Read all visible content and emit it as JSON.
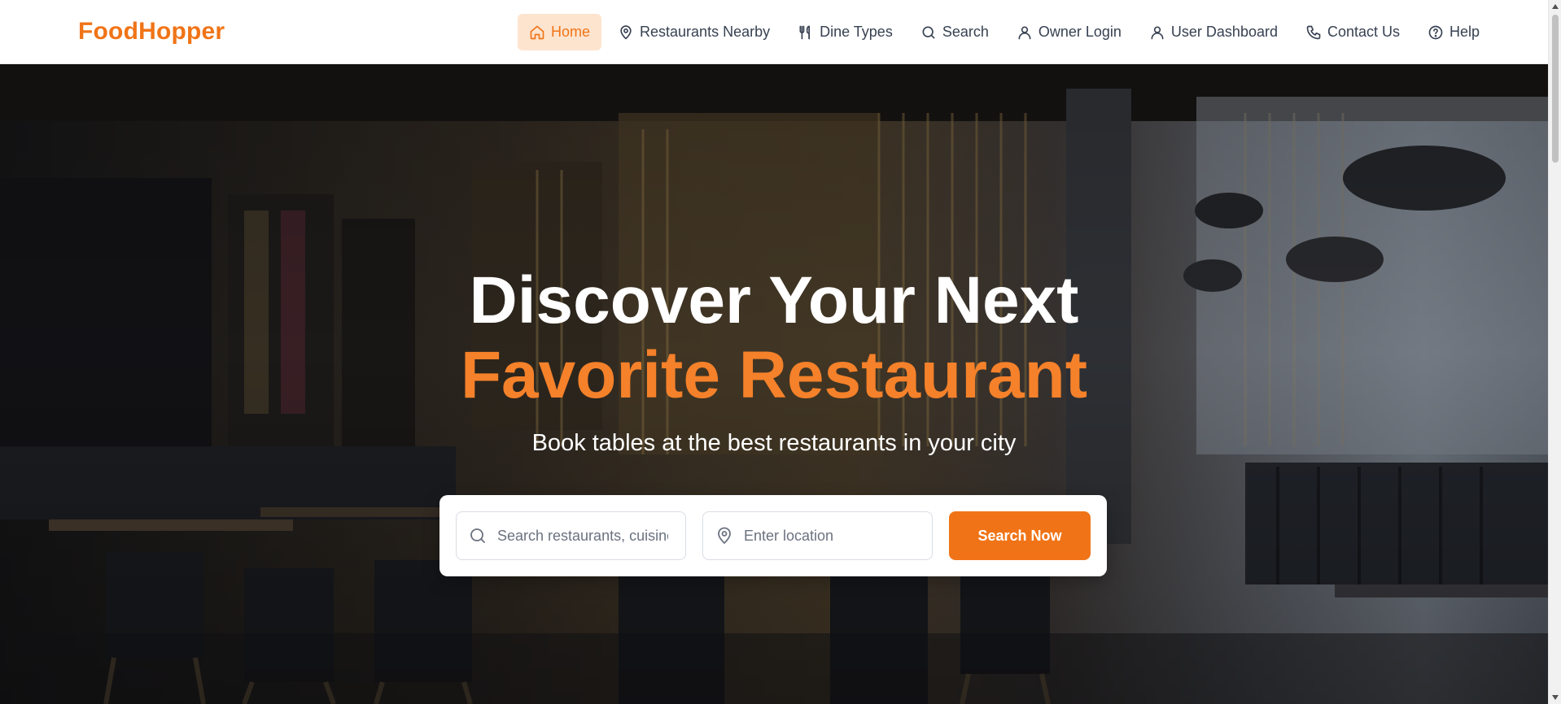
{
  "brand": {
    "name": "FoodHopper",
    "accent_color": "#f07417",
    "accent_light": "#fde4cf"
  },
  "nav": {
    "items": [
      {
        "label": "Home",
        "icon": "home-icon",
        "active": true
      },
      {
        "label": "Restaurants Nearby",
        "icon": "map-pin-icon",
        "active": false
      },
      {
        "label": "Dine Types",
        "icon": "utensils-icon",
        "active": false
      },
      {
        "label": "Search",
        "icon": "search-icon",
        "active": false
      },
      {
        "label": "Owner Login",
        "icon": "user-icon",
        "active": false
      },
      {
        "label": "User Dashboard",
        "icon": "user-icon",
        "active": false
      },
      {
        "label": "Contact Us",
        "icon": "phone-icon",
        "active": false
      },
      {
        "label": "Help",
        "icon": "help-circle-icon",
        "active": false
      }
    ]
  },
  "hero": {
    "title_line1": "Discover Your Next",
    "title_line2": "Favorite Restaurant",
    "subtitle": "Book tables at the best restaurants in your city",
    "background": "restaurant-interior-photo"
  },
  "search": {
    "query_placeholder": "Search restaurants, cuisines...",
    "query_value": "",
    "location_placeholder": "Enter location",
    "location_value": "",
    "button_label": "Search Now"
  }
}
